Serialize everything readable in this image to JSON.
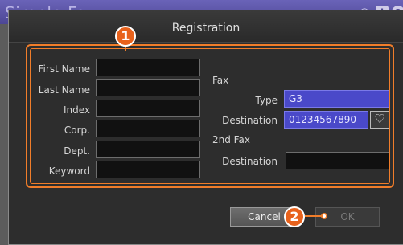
{
  "background_app": {
    "title": "Simple Fax"
  },
  "dialog": {
    "title": "Registration"
  },
  "callouts": {
    "first": "1",
    "second": "2"
  },
  "fields": {
    "first_name": {
      "label": "First Name",
      "value": ""
    },
    "last_name": {
      "label": "Last Name",
      "value": ""
    },
    "index": {
      "label": "Index",
      "value": ""
    },
    "corp": {
      "label": "Corp.",
      "value": ""
    },
    "dept": {
      "label": "Dept.",
      "value": ""
    },
    "keyword": {
      "label": "Keyword",
      "value": ""
    }
  },
  "fax": {
    "group_label": "Fax",
    "type_label": "Type",
    "type_value": "G3",
    "destination_label": "Destination",
    "destination_value": "01234567890"
  },
  "fax2": {
    "group_label": "2nd Fax",
    "destination_label": "Destination",
    "destination_value": ""
  },
  "buttons": {
    "cancel": "Cancel",
    "ok": "OK"
  },
  "colors": {
    "accent": "#f07d2a",
    "selection": "#4a49c9",
    "title_bar": "#5a53a8"
  }
}
